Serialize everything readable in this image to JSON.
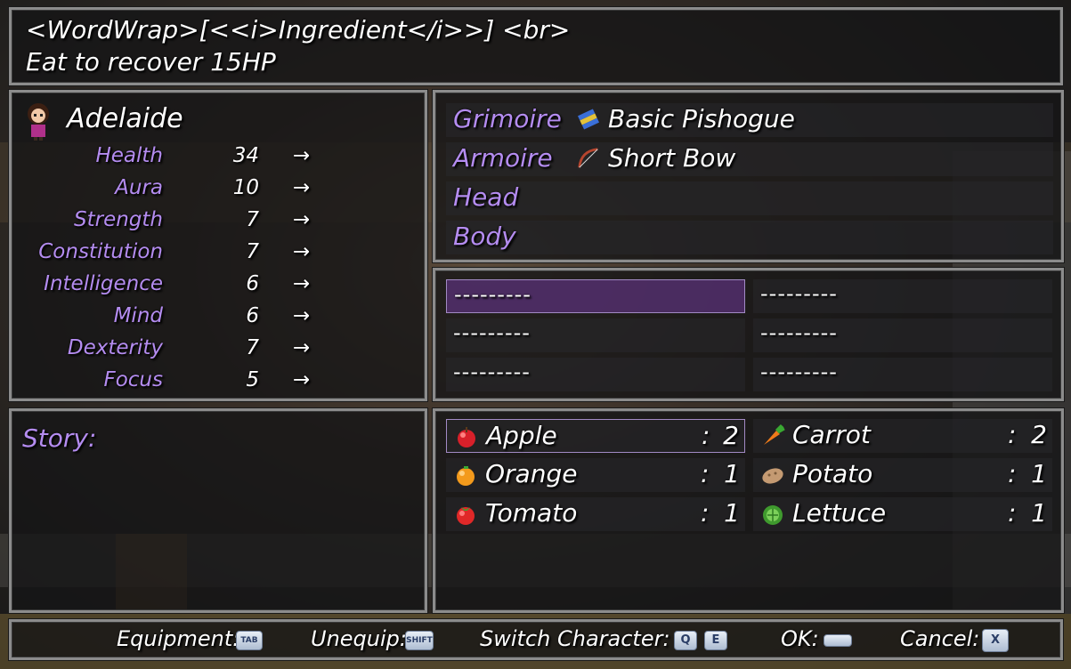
{
  "help": {
    "line1": "<WordWrap>[<<i>Ingredient</i>>] <br>",
    "line2": "Eat to recover 15HP"
  },
  "actor": {
    "name": "Adelaide",
    "stats": [
      {
        "label": "Health",
        "value": "34"
      },
      {
        "label": "Aura",
        "value": "10"
      },
      {
        "label": "Strength",
        "value": "7"
      },
      {
        "label": "Constitution",
        "value": "7"
      },
      {
        "label": "Intelligence",
        "value": "6"
      },
      {
        "label": "Mind",
        "value": "6"
      },
      {
        "label": "Dexterity",
        "value": "7"
      },
      {
        "label": "Focus",
        "value": "5"
      }
    ],
    "arrow": "→"
  },
  "story": {
    "label": "Story:"
  },
  "equip_slots": [
    {
      "label": "Grimoire",
      "item": "Basic Pishogue",
      "icon": "book-icon"
    },
    {
      "label": "Armoire",
      "item": "Short Bow",
      "icon": "bow-icon"
    },
    {
      "label": "Head",
      "item": ""
    },
    {
      "label": "Body",
      "item": ""
    }
  ],
  "empty_slots": [
    "---------",
    "---------",
    "---------",
    "---------",
    "---------",
    "---------"
  ],
  "items": [
    {
      "name": "Apple",
      "qty": "2",
      "icon": "apple-icon"
    },
    {
      "name": "Carrot",
      "qty": "2",
      "icon": "carrot-icon"
    },
    {
      "name": "Orange",
      "qty": "1",
      "icon": "orange-icon"
    },
    {
      "name": "Potato",
      "qty": "1",
      "icon": "potato-icon"
    },
    {
      "name": "Tomato",
      "qty": "1",
      "icon": "tomato-icon"
    },
    {
      "name": "Lettuce",
      "qty": "1",
      "icon": "lettuce-icon"
    }
  ],
  "colon": ":",
  "footer": {
    "equipment_label": "Equipment:",
    "equipment_key": "TAB",
    "unequip_label": "Unequip:",
    "unequip_key": "SHIFT",
    "switch_label": "Switch Character:",
    "switch_key1": "Q",
    "switch_key2": "E",
    "ok_label": "OK:",
    "cancel_label": "Cancel:",
    "cancel_key": "X"
  },
  "colors": {
    "accent_purple": "#b48cf0",
    "selection": "#5a3278",
    "border": "#8c8c8c"
  }
}
